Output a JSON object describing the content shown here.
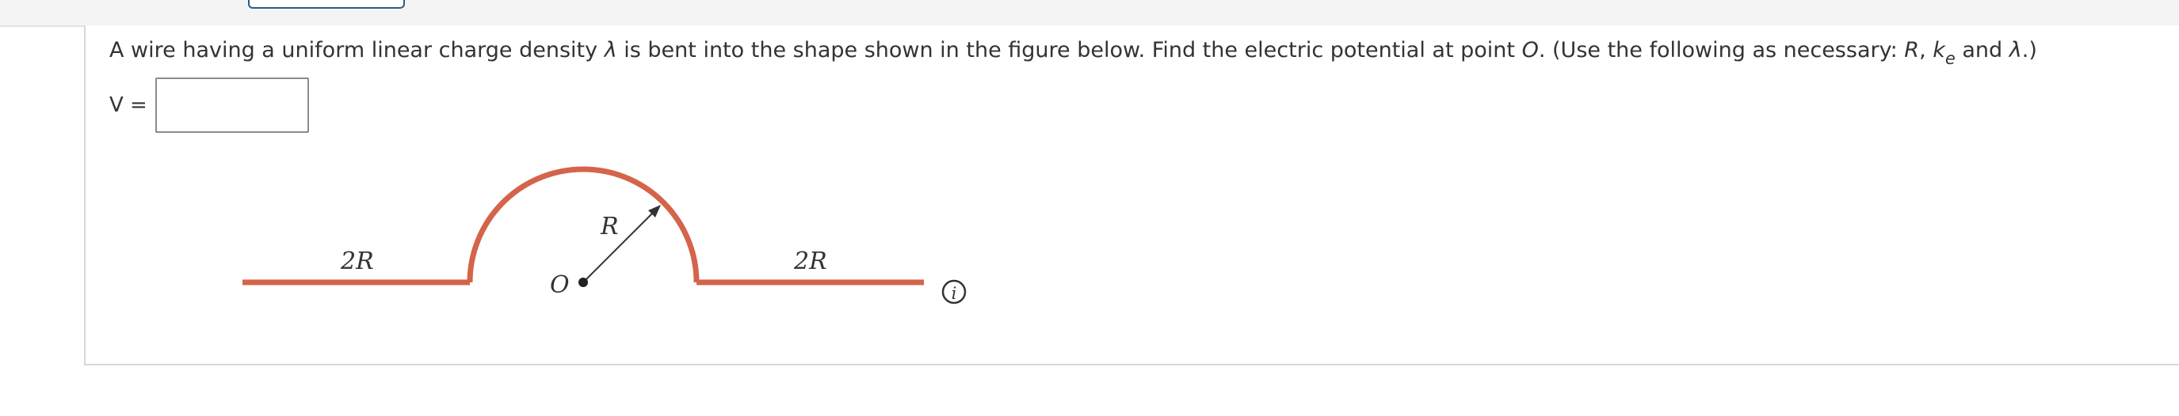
{
  "question": {
    "part1": "A wire having a uniform linear charge density ",
    "lambda": "λ",
    "part2": " is bent into the shape shown in the figure below. Find the electric potential at point ",
    "point": "O",
    "part3": ". (Use the following as necessary: ",
    "var_r": "R",
    "comma": ", ",
    "var_k": "k",
    "var_k_sub": "e",
    "and": " and ",
    "lambda2": "λ",
    "end": ".)"
  },
  "answer": {
    "label": "V =",
    "value": ""
  },
  "figure": {
    "left_segment_label": "2R",
    "right_segment_label": "2R",
    "radius_label": "R",
    "center_label": "O",
    "wire_color": "#d4644a",
    "info_icon": "info-icon",
    "info_glyph": "i"
  }
}
